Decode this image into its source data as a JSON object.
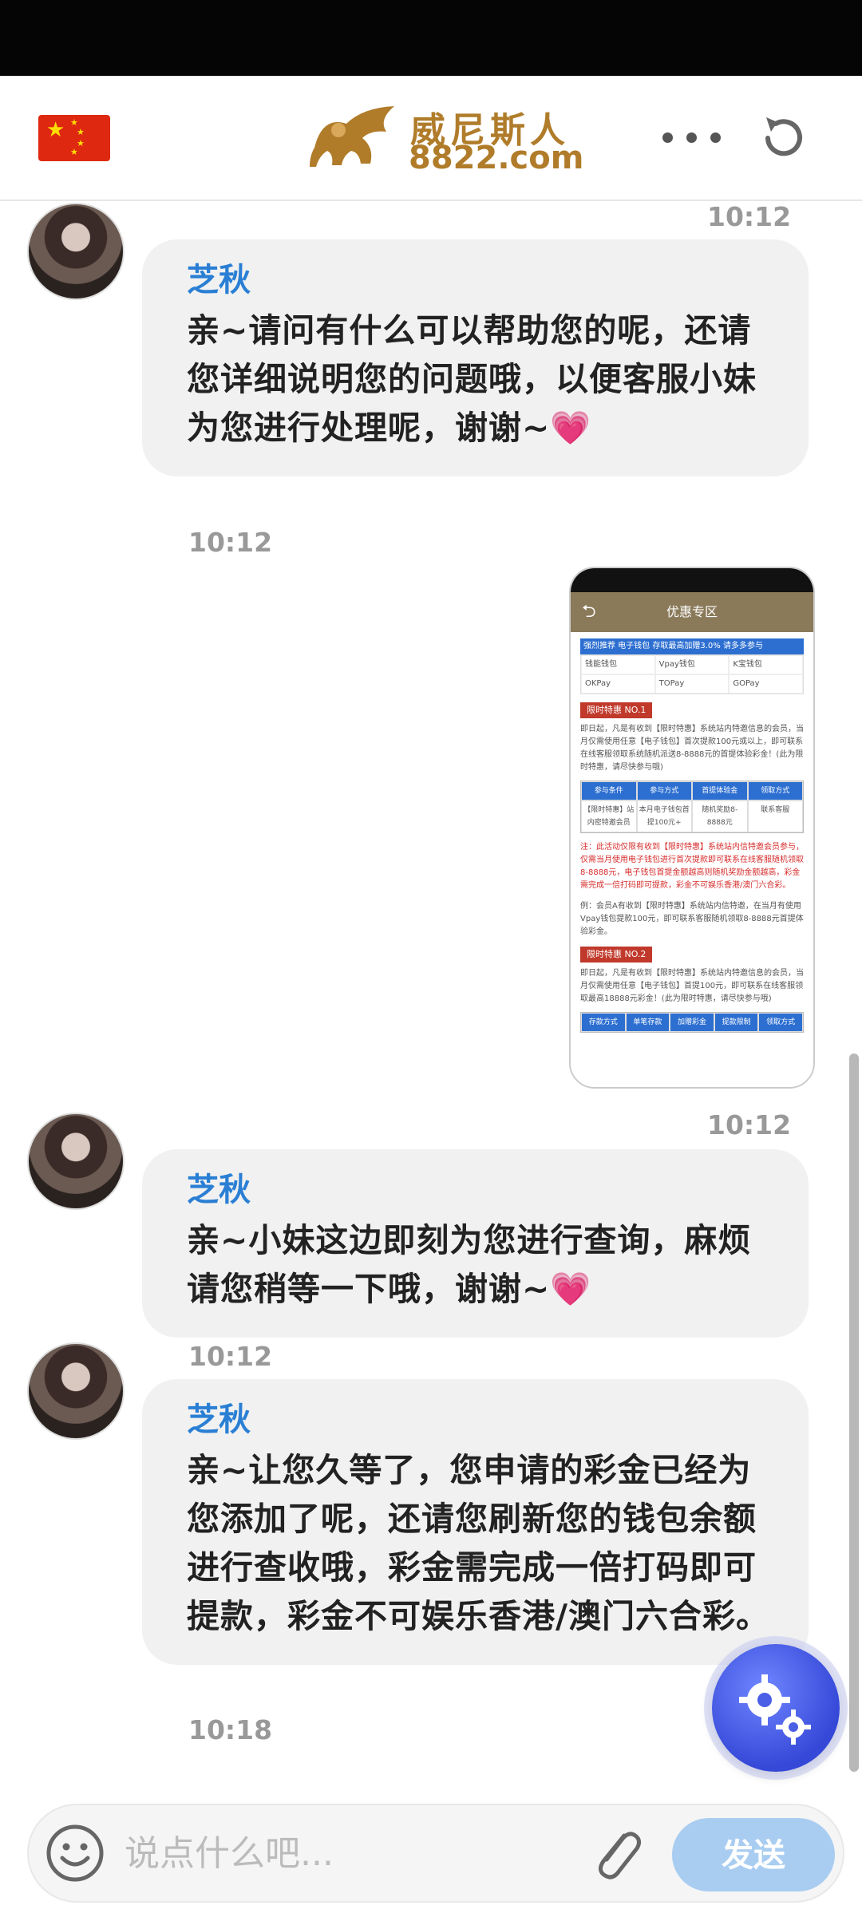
{
  "header": {
    "logo_text": "威尼斯人",
    "logo_url": "8822.com"
  },
  "messages": [
    {
      "time_top": "10:12",
      "sender": "芝秋",
      "text": "亲~请问有什么可以帮助您的呢，还请您详细说明您的问题哦，以便客服小妹为您进行处理呢，谢谢~",
      "emoji": "💗",
      "time_bottom": "10:12"
    },
    {
      "sender": "芝秋",
      "text": "亲~小妹这边即刻为您进行查询，麻烦请您稍等一下哦，谢谢~",
      "emoji": "💗",
      "time_bottom": "10:12"
    },
    {
      "sender": "芝秋",
      "text": "亲~让您久等了，您申请的彩金已经为您添加了呢，还请您刷新您的钱包余额进行查收哦，彩金需完成一倍打码即可提款，彩金不可娱乐香港/澳门六合彩。",
      "time_bottom": "10:18"
    }
  ],
  "image_message": {
    "time": "10:12",
    "nav_title": "优惠专区",
    "banner": "强烈推荐 电子钱包 存取最高加赠3.0% 请多多参与",
    "wallets": [
      "钱能钱包",
      "Vpay钱包",
      "K宝钱包",
      "OKPay",
      "TOPay",
      "GOPay"
    ],
    "promo1_tag": "限时特惠 NO.1",
    "promo1_text": "即日起，凡是有收到【限时特惠】系统站内特邀信息的会员，当月仅需使用任意【电子钱包】首次提款100元或以上，即可联系在线客服领取系统随机派送8-8888元的首提体验彩金！(此为限时特惠，请尽快参与哦)",
    "table1_headers": [
      "参与条件",
      "参与方式",
      "首提体验金",
      "领取方式"
    ],
    "table1_row": [
      "【限时特惠】站内密特邀会员",
      "本月电子钱包首提100元+",
      "随机奖励8-8888元",
      "联系客服"
    ],
    "promo1_note": "注：此活动仅限有收到【限时特惠】系统站内信特邀会员参与，仅需当月使用电子钱包进行首次提款即可联系在线客服随机领取8-8888元，电子钱包首提金额越高则随机奖励金额越高，彩金需完成一倍打码即可提款，彩金不可娱乐香港/澳门六合彩。",
    "promo1_example": "例：会员A有收到【限时特惠】系统站内信特邀，在当月有使用Vpay钱包提款100元，即可联系客服随机领取8-8888元首提体验彩金。",
    "promo2_tag": "限时特惠 NO.2",
    "promo2_text": "即日起，凡是有收到【限时特惠】系统站内特邀信息的会员，当月仅需使用任意【电子钱包】首提100元，即可联系在线客服领取最高18888元彩金！(此为限时特惠，请尽快参与哦)",
    "table2_headers": [
      "存款方式",
      "单笔存款",
      "加赠彩金",
      "提款限制",
      "领取方式"
    ]
  },
  "input": {
    "placeholder": "说点什么吧...",
    "send_label": "发送"
  }
}
